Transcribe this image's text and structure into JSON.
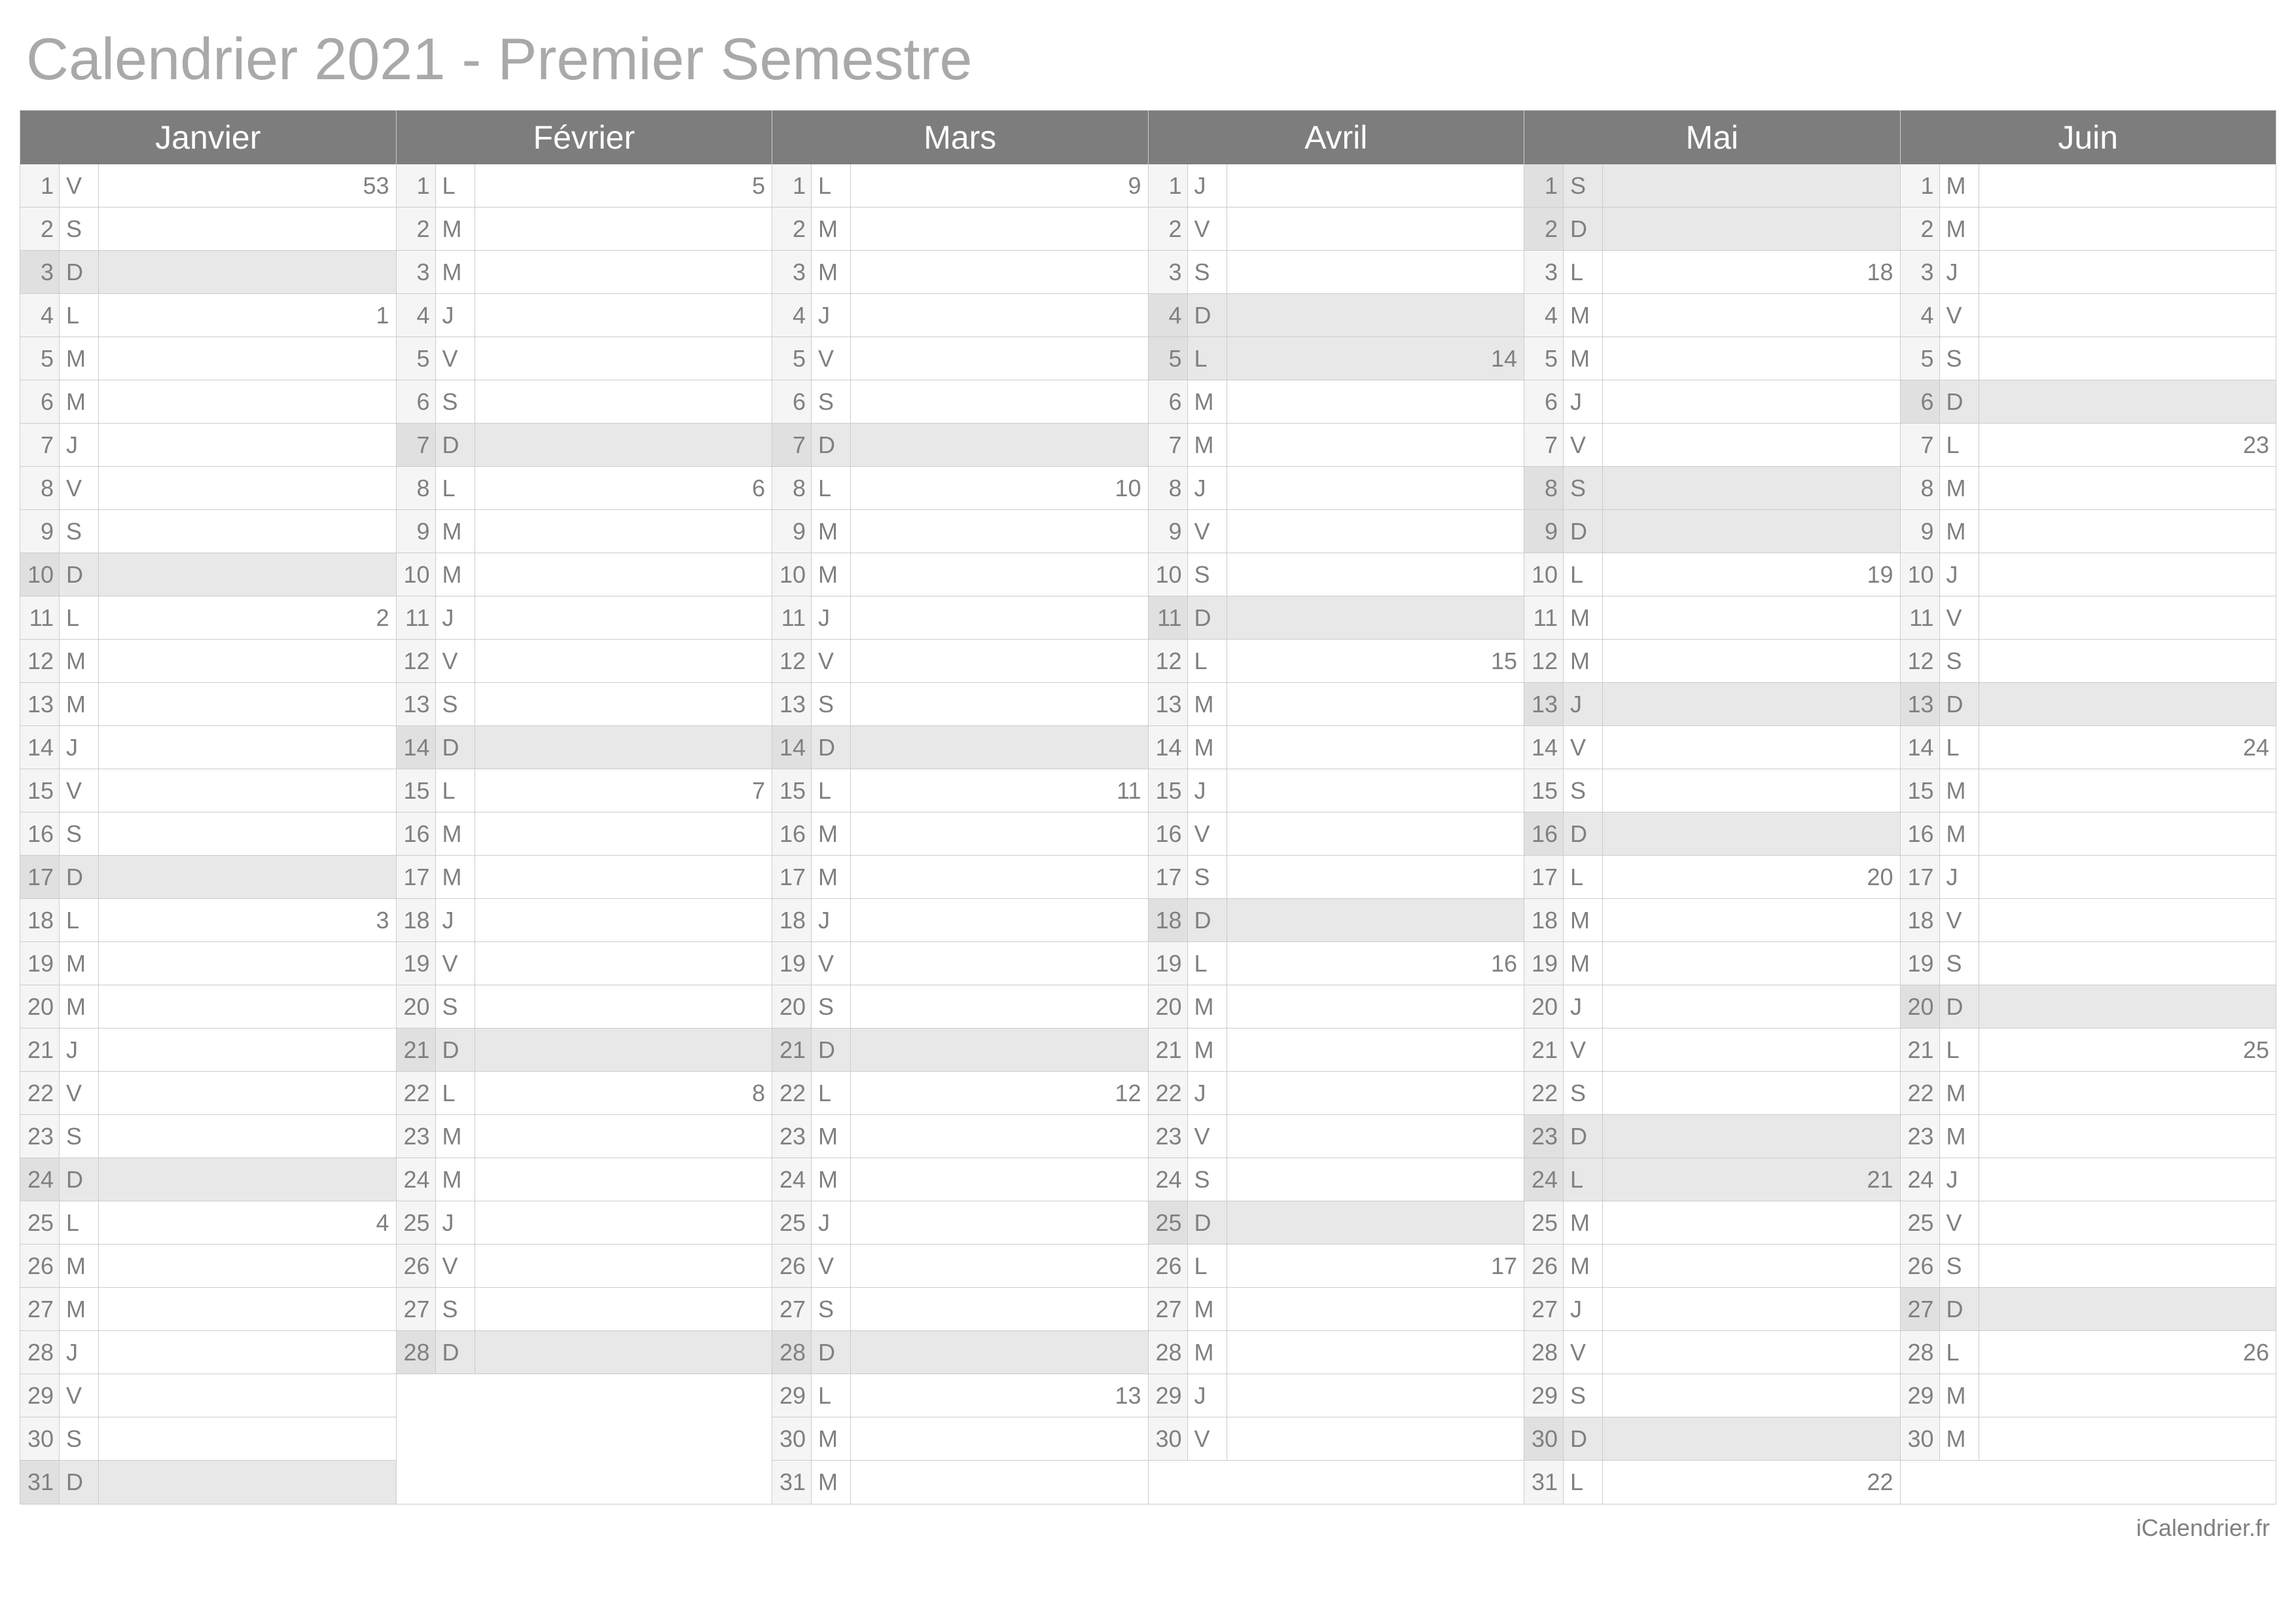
{
  "title": "Calendrier 2021 - Premier Semestre",
  "footer": "iCalendrier.fr",
  "months": [
    {
      "name": "Janvier",
      "days": [
        {
          "n": 1,
          "d": "V",
          "note": "53",
          "w": false
        },
        {
          "n": 2,
          "d": "S",
          "note": "",
          "w": false
        },
        {
          "n": 3,
          "d": "D",
          "note": "",
          "w": true
        },
        {
          "n": 4,
          "d": "L",
          "note": "1",
          "w": false
        },
        {
          "n": 5,
          "d": "M",
          "note": "",
          "w": false
        },
        {
          "n": 6,
          "d": "M",
          "note": "",
          "w": false
        },
        {
          "n": 7,
          "d": "J",
          "note": "",
          "w": false
        },
        {
          "n": 8,
          "d": "V",
          "note": "",
          "w": false
        },
        {
          "n": 9,
          "d": "S",
          "note": "",
          "w": false
        },
        {
          "n": 10,
          "d": "D",
          "note": "",
          "w": true
        },
        {
          "n": 11,
          "d": "L",
          "note": "2",
          "w": false
        },
        {
          "n": 12,
          "d": "M",
          "note": "",
          "w": false
        },
        {
          "n": 13,
          "d": "M",
          "note": "",
          "w": false
        },
        {
          "n": 14,
          "d": "J",
          "note": "",
          "w": false
        },
        {
          "n": 15,
          "d": "V",
          "note": "",
          "w": false
        },
        {
          "n": 16,
          "d": "S",
          "note": "",
          "w": false
        },
        {
          "n": 17,
          "d": "D",
          "note": "",
          "w": true
        },
        {
          "n": 18,
          "d": "L",
          "note": "3",
          "w": false
        },
        {
          "n": 19,
          "d": "M",
          "note": "",
          "w": false
        },
        {
          "n": 20,
          "d": "M",
          "note": "",
          "w": false
        },
        {
          "n": 21,
          "d": "J",
          "note": "",
          "w": false
        },
        {
          "n": 22,
          "d": "V",
          "note": "",
          "w": false
        },
        {
          "n": 23,
          "d": "S",
          "note": "",
          "w": false
        },
        {
          "n": 24,
          "d": "D",
          "note": "",
          "w": true
        },
        {
          "n": 25,
          "d": "L",
          "note": "4",
          "w": false
        },
        {
          "n": 26,
          "d": "M",
          "note": "",
          "w": false
        },
        {
          "n": 27,
          "d": "M",
          "note": "",
          "w": false
        },
        {
          "n": 28,
          "d": "J",
          "note": "",
          "w": false
        },
        {
          "n": 29,
          "d": "V",
          "note": "",
          "w": false
        },
        {
          "n": 30,
          "d": "S",
          "note": "",
          "w": false
        },
        {
          "n": 31,
          "d": "D",
          "note": "",
          "w": true
        }
      ]
    },
    {
      "name": "Février",
      "days": [
        {
          "n": 1,
          "d": "L",
          "note": "5",
          "w": false
        },
        {
          "n": 2,
          "d": "M",
          "note": "",
          "w": false
        },
        {
          "n": 3,
          "d": "M",
          "note": "",
          "w": false
        },
        {
          "n": 4,
          "d": "J",
          "note": "",
          "w": false
        },
        {
          "n": 5,
          "d": "V",
          "note": "",
          "w": false
        },
        {
          "n": 6,
          "d": "S",
          "note": "",
          "w": false
        },
        {
          "n": 7,
          "d": "D",
          "note": "",
          "w": true
        },
        {
          "n": 8,
          "d": "L",
          "note": "6",
          "w": false
        },
        {
          "n": 9,
          "d": "M",
          "note": "",
          "w": false
        },
        {
          "n": 10,
          "d": "M",
          "note": "",
          "w": false
        },
        {
          "n": 11,
          "d": "J",
          "note": "",
          "w": false
        },
        {
          "n": 12,
          "d": "V",
          "note": "",
          "w": false
        },
        {
          "n": 13,
          "d": "S",
          "note": "",
          "w": false
        },
        {
          "n": 14,
          "d": "D",
          "note": "",
          "w": true
        },
        {
          "n": 15,
          "d": "L",
          "note": "7",
          "w": false
        },
        {
          "n": 16,
          "d": "M",
          "note": "",
          "w": false
        },
        {
          "n": 17,
          "d": "M",
          "note": "",
          "w": false
        },
        {
          "n": 18,
          "d": "J",
          "note": "",
          "w": false
        },
        {
          "n": 19,
          "d": "V",
          "note": "",
          "w": false
        },
        {
          "n": 20,
          "d": "S",
          "note": "",
          "w": false
        },
        {
          "n": 21,
          "d": "D",
          "note": "",
          "w": true
        },
        {
          "n": 22,
          "d": "L",
          "note": "8",
          "w": false
        },
        {
          "n": 23,
          "d": "M",
          "note": "",
          "w": false
        },
        {
          "n": 24,
          "d": "M",
          "note": "",
          "w": false
        },
        {
          "n": 25,
          "d": "J",
          "note": "",
          "w": false
        },
        {
          "n": 26,
          "d": "V",
          "note": "",
          "w": false
        },
        {
          "n": 27,
          "d": "S",
          "note": "",
          "w": false
        },
        {
          "n": 28,
          "d": "D",
          "note": "",
          "w": true
        }
      ]
    },
    {
      "name": "Mars",
      "days": [
        {
          "n": 1,
          "d": "L",
          "note": "9",
          "w": false
        },
        {
          "n": 2,
          "d": "M",
          "note": "",
          "w": false
        },
        {
          "n": 3,
          "d": "M",
          "note": "",
          "w": false
        },
        {
          "n": 4,
          "d": "J",
          "note": "",
          "w": false
        },
        {
          "n": 5,
          "d": "V",
          "note": "",
          "w": false
        },
        {
          "n": 6,
          "d": "S",
          "note": "",
          "w": false
        },
        {
          "n": 7,
          "d": "D",
          "note": "",
          "w": true
        },
        {
          "n": 8,
          "d": "L",
          "note": "10",
          "w": false
        },
        {
          "n": 9,
          "d": "M",
          "note": "",
          "w": false
        },
        {
          "n": 10,
          "d": "M",
          "note": "",
          "w": false
        },
        {
          "n": 11,
          "d": "J",
          "note": "",
          "w": false
        },
        {
          "n": 12,
          "d": "V",
          "note": "",
          "w": false
        },
        {
          "n": 13,
          "d": "S",
          "note": "",
          "w": false
        },
        {
          "n": 14,
          "d": "D",
          "note": "",
          "w": true
        },
        {
          "n": 15,
          "d": "L",
          "note": "11",
          "w": false
        },
        {
          "n": 16,
          "d": "M",
          "note": "",
          "w": false
        },
        {
          "n": 17,
          "d": "M",
          "note": "",
          "w": false
        },
        {
          "n": 18,
          "d": "J",
          "note": "",
          "w": false
        },
        {
          "n": 19,
          "d": "V",
          "note": "",
          "w": false
        },
        {
          "n": 20,
          "d": "S",
          "note": "",
          "w": false
        },
        {
          "n": 21,
          "d": "D",
          "note": "",
          "w": true
        },
        {
          "n": 22,
          "d": "L",
          "note": "12",
          "w": false
        },
        {
          "n": 23,
          "d": "M",
          "note": "",
          "w": false
        },
        {
          "n": 24,
          "d": "M",
          "note": "",
          "w": false
        },
        {
          "n": 25,
          "d": "J",
          "note": "",
          "w": false
        },
        {
          "n": 26,
          "d": "V",
          "note": "",
          "w": false
        },
        {
          "n": 27,
          "d": "S",
          "note": "",
          "w": false
        },
        {
          "n": 28,
          "d": "D",
          "note": "",
          "w": true
        },
        {
          "n": 29,
          "d": "L",
          "note": "13",
          "w": false
        },
        {
          "n": 30,
          "d": "M",
          "note": "",
          "w": false
        },
        {
          "n": 31,
          "d": "M",
          "note": "",
          "w": false
        }
      ]
    },
    {
      "name": "Avril",
      "days": [
        {
          "n": 1,
          "d": "J",
          "note": "",
          "w": false
        },
        {
          "n": 2,
          "d": "V",
          "note": "",
          "w": false
        },
        {
          "n": 3,
          "d": "S",
          "note": "",
          "w": false
        },
        {
          "n": 4,
          "d": "D",
          "note": "",
          "w": true
        },
        {
          "n": 5,
          "d": "L",
          "note": "14",
          "w": true
        },
        {
          "n": 6,
          "d": "M",
          "note": "",
          "w": false
        },
        {
          "n": 7,
          "d": "M",
          "note": "",
          "w": false
        },
        {
          "n": 8,
          "d": "J",
          "note": "",
          "w": false
        },
        {
          "n": 9,
          "d": "V",
          "note": "",
          "w": false
        },
        {
          "n": 10,
          "d": "S",
          "note": "",
          "w": false
        },
        {
          "n": 11,
          "d": "D",
          "note": "",
          "w": true
        },
        {
          "n": 12,
          "d": "L",
          "note": "15",
          "w": false
        },
        {
          "n": 13,
          "d": "M",
          "note": "",
          "w": false
        },
        {
          "n": 14,
          "d": "M",
          "note": "",
          "w": false
        },
        {
          "n": 15,
          "d": "J",
          "note": "",
          "w": false
        },
        {
          "n": 16,
          "d": "V",
          "note": "",
          "w": false
        },
        {
          "n": 17,
          "d": "S",
          "note": "",
          "w": false
        },
        {
          "n": 18,
          "d": "D",
          "note": "",
          "w": true
        },
        {
          "n": 19,
          "d": "L",
          "note": "16",
          "w": false
        },
        {
          "n": 20,
          "d": "M",
          "note": "",
          "w": false
        },
        {
          "n": 21,
          "d": "M",
          "note": "",
          "w": false
        },
        {
          "n": 22,
          "d": "J",
          "note": "",
          "w": false
        },
        {
          "n": 23,
          "d": "V",
          "note": "",
          "w": false
        },
        {
          "n": 24,
          "d": "S",
          "note": "",
          "w": false
        },
        {
          "n": 25,
          "d": "D",
          "note": "",
          "w": true
        },
        {
          "n": 26,
          "d": "L",
          "note": "17",
          "w": false
        },
        {
          "n": 27,
          "d": "M",
          "note": "",
          "w": false
        },
        {
          "n": 28,
          "d": "M",
          "note": "",
          "w": false
        },
        {
          "n": 29,
          "d": "J",
          "note": "",
          "w": false
        },
        {
          "n": 30,
          "d": "V",
          "note": "",
          "w": false
        }
      ]
    },
    {
      "name": "Mai",
      "days": [
        {
          "n": 1,
          "d": "S",
          "note": "",
          "w": true
        },
        {
          "n": 2,
          "d": "D",
          "note": "",
          "w": true
        },
        {
          "n": 3,
          "d": "L",
          "note": "18",
          "w": false
        },
        {
          "n": 4,
          "d": "M",
          "note": "",
          "w": false
        },
        {
          "n": 5,
          "d": "M",
          "note": "",
          "w": false
        },
        {
          "n": 6,
          "d": "J",
          "note": "",
          "w": false
        },
        {
          "n": 7,
          "d": "V",
          "note": "",
          "w": false
        },
        {
          "n": 8,
          "d": "S",
          "note": "",
          "w": true
        },
        {
          "n": 9,
          "d": "D",
          "note": "",
          "w": true
        },
        {
          "n": 10,
          "d": "L",
          "note": "19",
          "w": false
        },
        {
          "n": 11,
          "d": "M",
          "note": "",
          "w": false
        },
        {
          "n": 12,
          "d": "M",
          "note": "",
          "w": false
        },
        {
          "n": 13,
          "d": "J",
          "note": "",
          "w": true
        },
        {
          "n": 14,
          "d": "V",
          "note": "",
          "w": false
        },
        {
          "n": 15,
          "d": "S",
          "note": "",
          "w": false
        },
        {
          "n": 16,
          "d": "D",
          "note": "",
          "w": true
        },
        {
          "n": 17,
          "d": "L",
          "note": "20",
          "w": false
        },
        {
          "n": 18,
          "d": "M",
          "note": "",
          "w": false
        },
        {
          "n": 19,
          "d": "M",
          "note": "",
          "w": false
        },
        {
          "n": 20,
          "d": "J",
          "note": "",
          "w": false
        },
        {
          "n": 21,
          "d": "V",
          "note": "",
          "w": false
        },
        {
          "n": 22,
          "d": "S",
          "note": "",
          "w": false
        },
        {
          "n": 23,
          "d": "D",
          "note": "",
          "w": true
        },
        {
          "n": 24,
          "d": "L",
          "note": "21",
          "w": true
        },
        {
          "n": 25,
          "d": "M",
          "note": "",
          "w": false
        },
        {
          "n": 26,
          "d": "M",
          "note": "",
          "w": false
        },
        {
          "n": 27,
          "d": "J",
          "note": "",
          "w": false
        },
        {
          "n": 28,
          "d": "V",
          "note": "",
          "w": false
        },
        {
          "n": 29,
          "d": "S",
          "note": "",
          "w": false
        },
        {
          "n": 30,
          "d": "D",
          "note": "",
          "w": true
        },
        {
          "n": 31,
          "d": "L",
          "note": "22",
          "w": false
        }
      ]
    },
    {
      "name": "Juin",
      "days": [
        {
          "n": 1,
          "d": "M",
          "note": "",
          "w": false
        },
        {
          "n": 2,
          "d": "M",
          "note": "",
          "w": false
        },
        {
          "n": 3,
          "d": "J",
          "note": "",
          "w": false
        },
        {
          "n": 4,
          "d": "V",
          "note": "",
          "w": false
        },
        {
          "n": 5,
          "d": "S",
          "note": "",
          "w": false
        },
        {
          "n": 6,
          "d": "D",
          "note": "",
          "w": true
        },
        {
          "n": 7,
          "d": "L",
          "note": "23",
          "w": false
        },
        {
          "n": 8,
          "d": "M",
          "note": "",
          "w": false
        },
        {
          "n": 9,
          "d": "M",
          "note": "",
          "w": false
        },
        {
          "n": 10,
          "d": "J",
          "note": "",
          "w": false
        },
        {
          "n": 11,
          "d": "V",
          "note": "",
          "w": false
        },
        {
          "n": 12,
          "d": "S",
          "note": "",
          "w": false
        },
        {
          "n": 13,
          "d": "D",
          "note": "",
          "w": true
        },
        {
          "n": 14,
          "d": "L",
          "note": "24",
          "w": false
        },
        {
          "n": 15,
          "d": "M",
          "note": "",
          "w": false
        },
        {
          "n": 16,
          "d": "M",
          "note": "",
          "w": false
        },
        {
          "n": 17,
          "d": "J",
          "note": "",
          "w": false
        },
        {
          "n": 18,
          "d": "V",
          "note": "",
          "w": false
        },
        {
          "n": 19,
          "d": "S",
          "note": "",
          "w": false
        },
        {
          "n": 20,
          "d": "D",
          "note": "",
          "w": true
        },
        {
          "n": 21,
          "d": "L",
          "note": "25",
          "w": false
        },
        {
          "n": 22,
          "d": "M",
          "note": "",
          "w": false
        },
        {
          "n": 23,
          "d": "M",
          "note": "",
          "w": false
        },
        {
          "n": 24,
          "d": "J",
          "note": "",
          "w": false
        },
        {
          "n": 25,
          "d": "V",
          "note": "",
          "w": false
        },
        {
          "n": 26,
          "d": "S",
          "note": "",
          "w": false
        },
        {
          "n": 27,
          "d": "D",
          "note": "",
          "w": true
        },
        {
          "n": 28,
          "d": "L",
          "note": "26",
          "w": false
        },
        {
          "n": 29,
          "d": "M",
          "note": "",
          "w": false
        },
        {
          "n": 30,
          "d": "M",
          "note": "",
          "w": false
        }
      ]
    }
  ]
}
